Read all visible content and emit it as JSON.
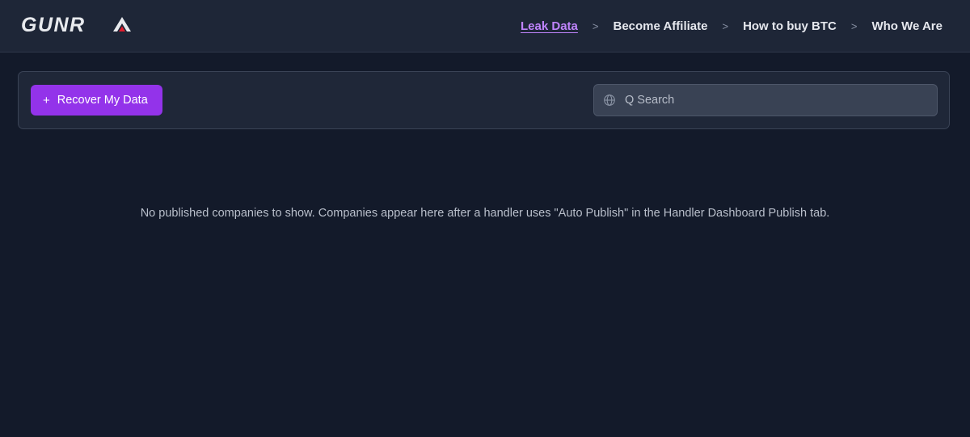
{
  "header": {
    "logo_text": "GUNRA",
    "nav": [
      {
        "label": "Leak Data",
        "active": true
      },
      {
        "label": "Become Affiliate",
        "active": false
      },
      {
        "label": "How to buy BTC",
        "active": false
      },
      {
        "label": "Who We Are",
        "active": false
      }
    ],
    "separator": ">"
  },
  "toolbar": {
    "recover_icon": "+",
    "recover_label": "Recover My Data",
    "search_icon": "globe-icon",
    "search_placeholder": "Q Search",
    "search_value": ""
  },
  "main": {
    "empty_message": "No published companies to show. Companies appear here after a handler uses \"Auto Publish\" in the Handler Dashboard Publish tab."
  },
  "colors": {
    "accent": "#9333ea",
    "active_link": "#c084fc",
    "background": "#131a2a",
    "header_bg": "#1e2637",
    "logo_red": "#e11d2e"
  }
}
